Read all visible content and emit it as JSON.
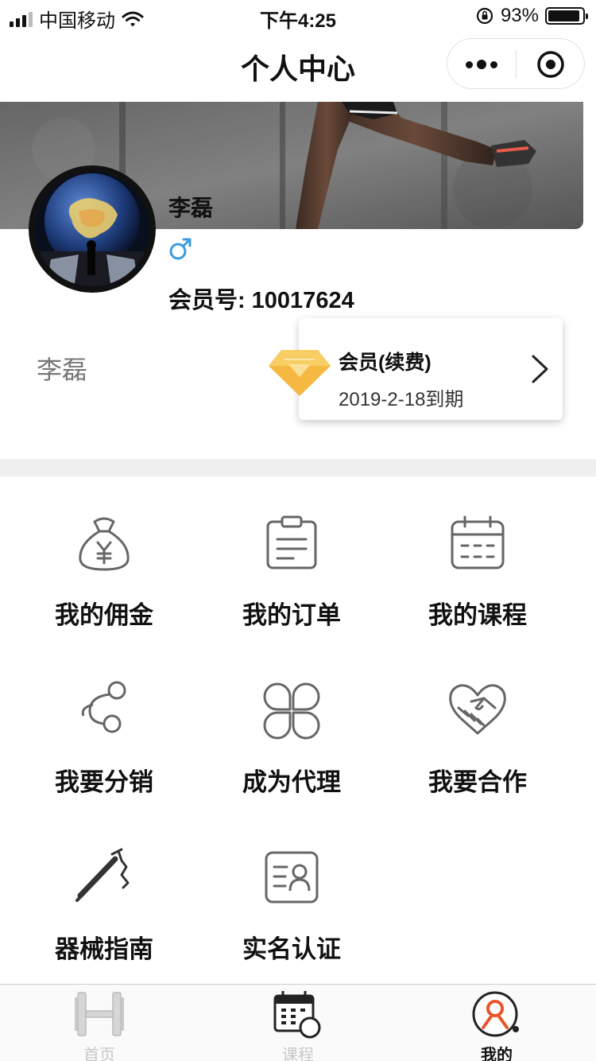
{
  "status_bar": {
    "carrier": "中国移动",
    "time": "下午4:25",
    "battery": "93%",
    "battery_level": 0.93
  },
  "nav": {
    "title": "个人中心",
    "more_icon": "more-dots-icon",
    "close_icon": "target-circle-icon"
  },
  "profile": {
    "name": "李磊",
    "gender_symbol": "♂",
    "member_label": "会员号:",
    "member_no": "10017624",
    "display_name": "李磊"
  },
  "membership": {
    "title": "会员(续费)",
    "expiry": "2019-2-18到期",
    "icon": "diamond-icon",
    "accent": "#f5b942"
  },
  "menu": [
    {
      "label": "我的佣金",
      "icon": "money-bag-icon"
    },
    {
      "label": "我的订单",
      "icon": "clipboard-icon"
    },
    {
      "label": "我的课程",
      "icon": "calendar-icon"
    },
    {
      "label": "我要分销",
      "icon": "share-icon"
    },
    {
      "label": "成为代理",
      "icon": "clover-icon"
    },
    {
      "label": "我要合作",
      "icon": "handshake-icon"
    },
    {
      "label": "器械指南",
      "icon": "barbell-icon"
    },
    {
      "label": "实名认证",
      "icon": "id-card-icon"
    }
  ],
  "tabbar": {
    "items": [
      {
        "label": "首页",
        "icon": "dumbbell-icon",
        "active": false
      },
      {
        "label": "课程",
        "icon": "course-calendar-icon",
        "active": false
      },
      {
        "label": "我的",
        "icon": "user-avatar-icon",
        "active": true
      }
    ],
    "active_color": "#e9542a",
    "inactive_color": "#c8c8c8"
  }
}
